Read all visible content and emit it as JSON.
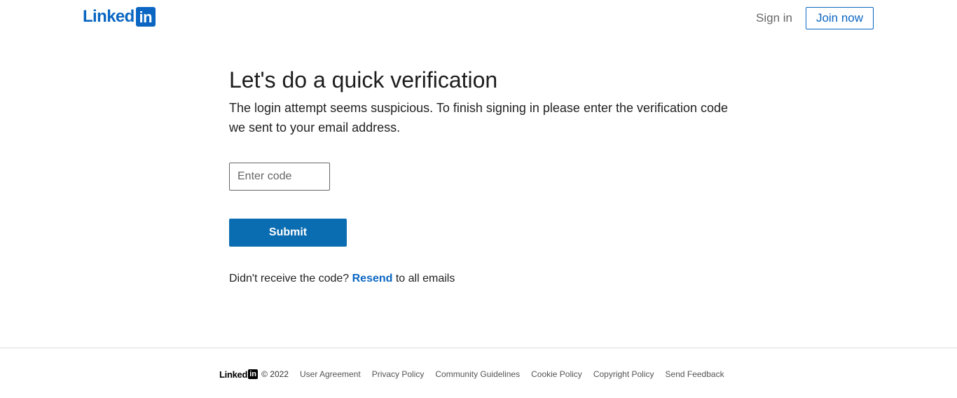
{
  "header": {
    "logo_text": "Linked",
    "logo_box": "in",
    "sign_in_label": "Sign in",
    "join_now_label": "Join now"
  },
  "main": {
    "title": "Let's do a quick verification",
    "description": "The login attempt seems suspicious. To finish signing in please enter the verification code we sent to your email address.",
    "code_input": {
      "value": "",
      "placeholder": "Enter code"
    },
    "submit_label": "Submit",
    "resend": {
      "prefix": "Didn't receive the code?",
      "link_label": "Resend",
      "suffix": "to all emails"
    }
  },
  "footer": {
    "logo_text": "Linked",
    "logo_box": "in",
    "copyright": "© 2022",
    "links": [
      "User Agreement",
      "Privacy Policy",
      "Community Guidelines",
      "Cookie Policy",
      "Copyright Policy",
      "Send Feedback"
    ]
  },
  "colors": {
    "brand": "#0a66c2",
    "submit_bg": "#0b6db1",
    "footer_divider": "#dddddd"
  }
}
